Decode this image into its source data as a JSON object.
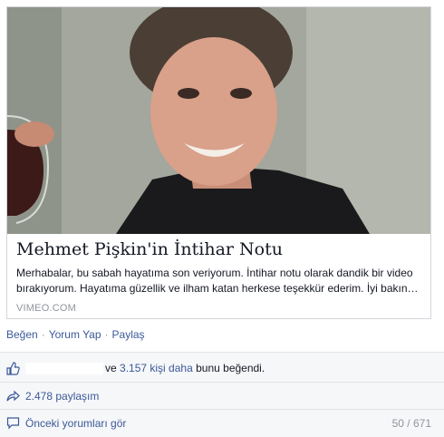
{
  "card": {
    "title": "Mehmet Pişkin'in İntihar Notu",
    "description": "Merhabalar, bu sabah hayatıma son veriyorum. İntihar notu olarak dandik bir video bırakıyorum. Hayatıma güzellik ve ilham katan herkese teşekkür ederim. İyi bakın…",
    "source": "VIMEO.COM"
  },
  "actions": {
    "like": "Beğen",
    "comment": "Yorum Yap",
    "share": "Paylaş",
    "separator": "·"
  },
  "likes": {
    "prefix": "ve",
    "others_link": "3.157 kişi daha",
    "suffix": "bunu beğendi."
  },
  "shares": {
    "label": "2.478 paylaşım"
  },
  "comments": {
    "previous": "Önceki yorumları gör",
    "count": "50 / 671"
  },
  "colors": {
    "link": "#3b5998",
    "muted": "#90949c",
    "ufi_bg": "#f6f7f9"
  },
  "icons": [
    "thumbs-up-icon",
    "share-arrow-icon",
    "comment-bubble-icon"
  ]
}
